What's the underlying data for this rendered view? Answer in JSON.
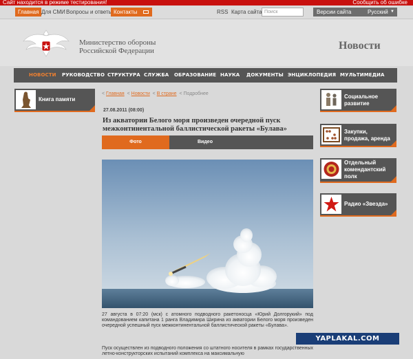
{
  "testbar": {
    "text": "Сайт находится в режиме тестирования!",
    "report": "Сообщить об ошибке"
  },
  "topnav": {
    "items": [
      "Главная",
      "Для СМИ",
      "Вопросы и ответы",
      "Контакты"
    ],
    "rss": "RSS",
    "sitemap": "Карта сайта",
    "search_placeholder": "Поиск",
    "versions": "Версии сайта",
    "language": "Русский"
  },
  "header": {
    "ministry_line1": "Министерство обороны",
    "ministry_line2": "Российской Федерации",
    "section_title": "Новости"
  },
  "menu": [
    "НОВОСТИ",
    "РУКОВОДСТВО",
    "СТРУКТУРА",
    "СЛУЖБА",
    "ОБРАЗОВАНИЕ",
    "НАУКА",
    "ДОКУМЕНТЫ",
    "ЭНЦИКЛОПЕДИЯ",
    "МУЛЬТИМЕДИА"
  ],
  "left": {
    "book_memory": "Книга памяти"
  },
  "breadcrumb": {
    "home": "Главная",
    "news": "Новости",
    "country": "В стране",
    "current": "Подробнее"
  },
  "article": {
    "date": "27.08.2011 (08:00)",
    "title": "Из акватории Белого моря произведен очередной пуск межконтинентальной баллистической ракеты «Булава»",
    "tab_photo": "Фото",
    "tab_video": "Видео",
    "p1": "27 августа в 07:20 (мск) с атомного подводного ракетоносца «Юрий Долгорукий» под командованием капитана 1 ранга Владимира Ширина из акватории Белого моря произведен очередной успешный пуск межконтинентальной баллистической ракеты «Булава».",
    "p2": "Пуск осуществлен из подводного положения со штатного носителя в рамках государственных летно-конструкторских испытаний комплекса на максимальную"
  },
  "right": [
    {
      "label": "Социальное развитие"
    },
    {
      "label": "Закупки, продажа, аренда"
    },
    {
      "label": "Отдельный комендантский полк"
    },
    {
      "label": "Радио «Звезда»"
    }
  ],
  "watermark": "YAPLAKAL.COM"
}
